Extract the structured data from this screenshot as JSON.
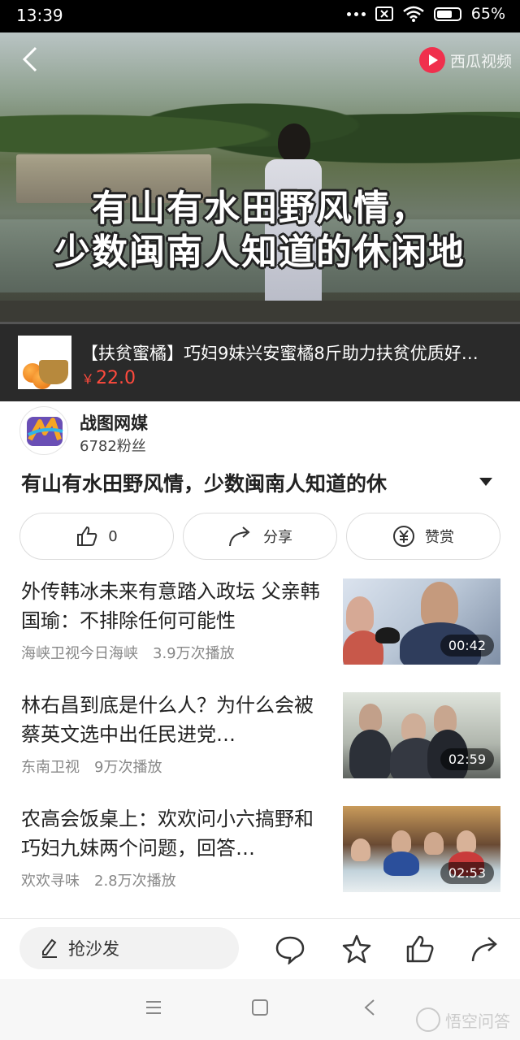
{
  "status_bar": {
    "time": "13:39",
    "battery": "65%"
  },
  "video": {
    "platform_logo_text": "西瓜视频",
    "caption_line1": "有山有水田野风情，",
    "caption_line2": "少数闽南人知道的休闲地",
    "progress": 0.0
  },
  "ad": {
    "title": "【扶贫蜜橘】巧妇9妹兴安蜜橘8斤助力扶贫优质好…",
    "currency": "￥",
    "price": "22.0"
  },
  "author": {
    "name": "战图网媒",
    "fans": "6782粉丝"
  },
  "article": {
    "title": "有山有水田野风情，少数闽南人知道的休"
  },
  "actions": {
    "like_count": "0",
    "share_label": "分享",
    "reward_label": "赞赏"
  },
  "related": [
    {
      "title": "外传韩冰未来有意踏入政坛 父亲韩国瑜：不排除任何可能性",
      "source": "海峡卫视今日海峡",
      "plays": "3.9万次播放",
      "duration": "00:42"
    },
    {
      "title": "林右昌到底是什么人？为什么会被蔡英文选中出任民进党…",
      "source": "东南卫视",
      "plays": "9万次播放",
      "duration": "02:59"
    },
    {
      "title": "农高会饭桌上：欢欢问小六搞野和巧妇九妹两个问题，回答…",
      "source": "欢欢寻味",
      "plays": "2.8万次播放",
      "duration": "02:53"
    }
  ],
  "bottom": {
    "comment_placeholder": "抢沙发"
  },
  "watermark": "悟空问答"
}
